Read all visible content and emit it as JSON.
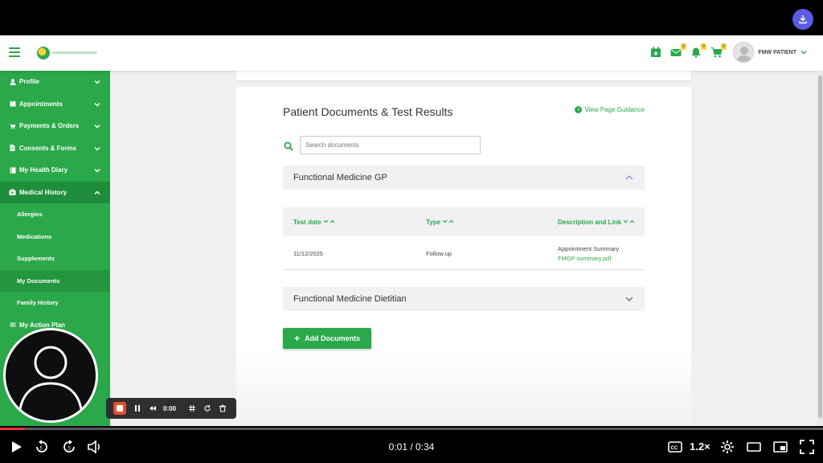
{
  "header": {
    "user_name": "FMW PATIENT",
    "badges": {
      "messages": "0",
      "notifications": "0",
      "cart": "0"
    }
  },
  "sidebar": {
    "items": [
      {
        "label": "Profile",
        "icon": "person-icon"
      },
      {
        "label": "Appointments",
        "icon": "calendar-icon"
      },
      {
        "label": "Payments & Orders",
        "icon": "cart-icon"
      },
      {
        "label": "Consents & Forms",
        "icon": "document-icon"
      },
      {
        "label": "My Health Diary",
        "icon": "book-icon"
      },
      {
        "label": "Medical History",
        "icon": "medical-bag-icon"
      }
    ],
    "sub_items": [
      {
        "label": "Allergies"
      },
      {
        "label": "Medications"
      },
      {
        "label": "Supplements"
      },
      {
        "label": "My Documents"
      },
      {
        "label": "Family History"
      }
    ],
    "after_items": [
      {
        "label": "My Action Plan",
        "icon": "list-icon"
      }
    ]
  },
  "page": {
    "title": "Patient Documents & Test Results",
    "guidance": "View Page Guidance",
    "search_placeholder": "Search documents",
    "sections": [
      {
        "title": "Functional Medicine GP",
        "expanded": true
      },
      {
        "title": "Functional Medicine Dietitian",
        "expanded": false
      }
    ],
    "table": {
      "headers": [
        "Test date",
        "Type",
        "Description and Link"
      ],
      "rows": [
        {
          "date": "11/12/2025",
          "type": "Follow up",
          "description": "Appointment Summary",
          "link": "FMGP summary.pdf"
        }
      ]
    },
    "add_button": "Add Documents"
  },
  "recorder": {
    "time": "0:00"
  },
  "player": {
    "time": "0:01 / 0:34",
    "speed": "1.2×",
    "progress_fraction": 0.03
  },
  "colors": {
    "brand_green": "#2aa84a",
    "dark_green": "#1f8e3c",
    "badge_yellow": "#f5d34a",
    "download_purple": "#5b5ce2",
    "record_red": "#e1502f"
  }
}
